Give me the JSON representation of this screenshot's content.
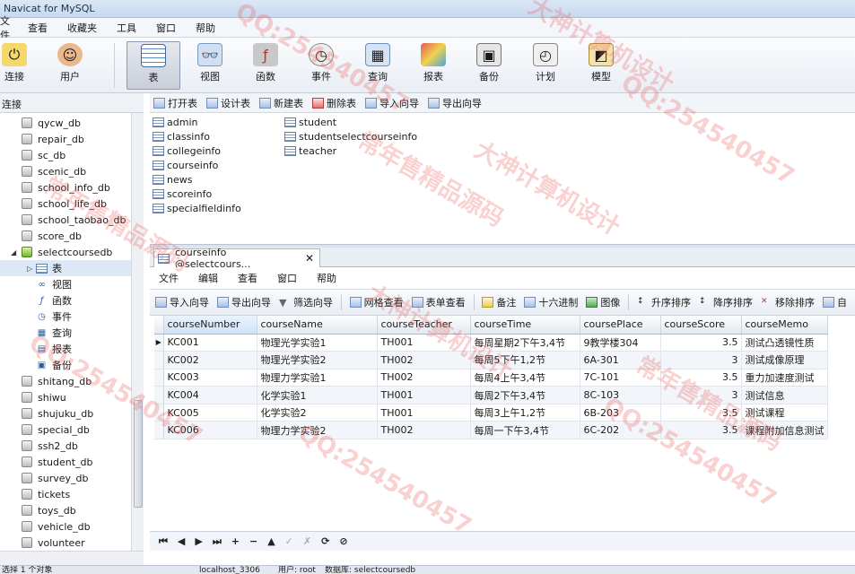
{
  "app": {
    "title": "Navicat for MySQL"
  },
  "menu": [
    "文件",
    "查看",
    "收藏夹",
    "工具",
    "窗口",
    "帮助"
  ],
  "toolbar": {
    "connect": "连接",
    "user": "用户",
    "table": "表",
    "view": "视图",
    "function": "函数",
    "event": "事件",
    "query": "查询",
    "report": "报表",
    "backup": "备份",
    "schedule": "计划",
    "model": "模型"
  },
  "left_header": "连接",
  "tree": {
    "databases_top": [
      "qycw_db",
      "repair_db",
      "sc_db",
      "scenic_db",
      "school_info_db",
      "school_life_db",
      "school_taobao_db",
      "score_db"
    ],
    "open_db": "selectcoursedb",
    "children": [
      "表",
      "视图",
      "函数",
      "事件",
      "查询",
      "报表",
      "备份"
    ],
    "databases_bottom": [
      "shitang_db",
      "shiwu",
      "shujuku_db",
      "special_db",
      "ssh2_db",
      "student_db",
      "survey_db",
      "tickets",
      "toys_db",
      "vehicle_db",
      "volunteer"
    ]
  },
  "objbar": {
    "open": "打开表",
    "design": "设计表",
    "new": "新建表",
    "delete": "删除表",
    "import": "导入向导",
    "export": "导出向导"
  },
  "objects": {
    "col1": [
      "admin",
      "classinfo",
      "collegeinfo",
      "courseinfo",
      "news",
      "scoreinfo",
      "specialfieldinfo"
    ],
    "col2": [
      "student",
      "studentselectcourseinfo",
      "teacher"
    ]
  },
  "tab": {
    "label": "courseinfo @selectcours...",
    "close": "✕"
  },
  "submenu": [
    "文件",
    "编辑",
    "查看",
    "窗口",
    "帮助"
  ],
  "subtoolbar": {
    "import": "导入向导",
    "export": "导出向导",
    "filter": "筛选向导",
    "grid_view": "网格查看",
    "form_view": "表单查看",
    "memo": "备注",
    "hex": "十六进制",
    "image": "图像",
    "asc": "升序排序",
    "desc": "降序排序",
    "remove_sort": "移除排序",
    "auto": "自"
  },
  "grid": {
    "columns": [
      "courseNumber",
      "courseName",
      "courseTeacher",
      "courseTime",
      "coursePlace",
      "courseScore",
      "courseMemo"
    ],
    "rows": [
      [
        "KC001",
        "物理光学实验1",
        "TH001",
        "每周星期2下午3,4节",
        "9教学楼304",
        "3.5",
        "测试凸透镜性质"
      ],
      [
        "KC002",
        "物理光学实验2",
        "TH002",
        "每周5下午1,2节",
        "6A-301",
        "3",
        "测试成像原理"
      ],
      [
        "KC003",
        "物理力学实验1",
        "TH002",
        "每周4上午3,4节",
        "7C-101",
        "3.5",
        "重力加速度测试"
      ],
      [
        "KC004",
        "化学实验1",
        "TH001",
        "每周2下午3,4节",
        "8C-103",
        "3",
        "测试信息"
      ],
      [
        "KC005",
        "化学实验2",
        "TH001",
        "每周3上午1,2节",
        "6B-203",
        "3.5",
        "测试课程"
      ],
      [
        "KC006",
        "物理力学实验2",
        "TH002",
        "每周一下午3,4节",
        "6C-202",
        "3.5",
        "课程附加信息测试"
      ]
    ]
  },
  "navbar": [
    "⏮",
    "◀",
    "▶",
    "⏭",
    "+",
    "−",
    "▲",
    "✓",
    "✗",
    "⟳",
    "⊘"
  ],
  "status": {
    "left": "选择 1 个对象",
    "conn": "localhost_3306",
    "user": "用户: root",
    "db": "数据库: selectcoursedb"
  },
  "watermarks": [
    "QQ:254540457",
    "大神计算机设计",
    "常年售精品源码"
  ]
}
